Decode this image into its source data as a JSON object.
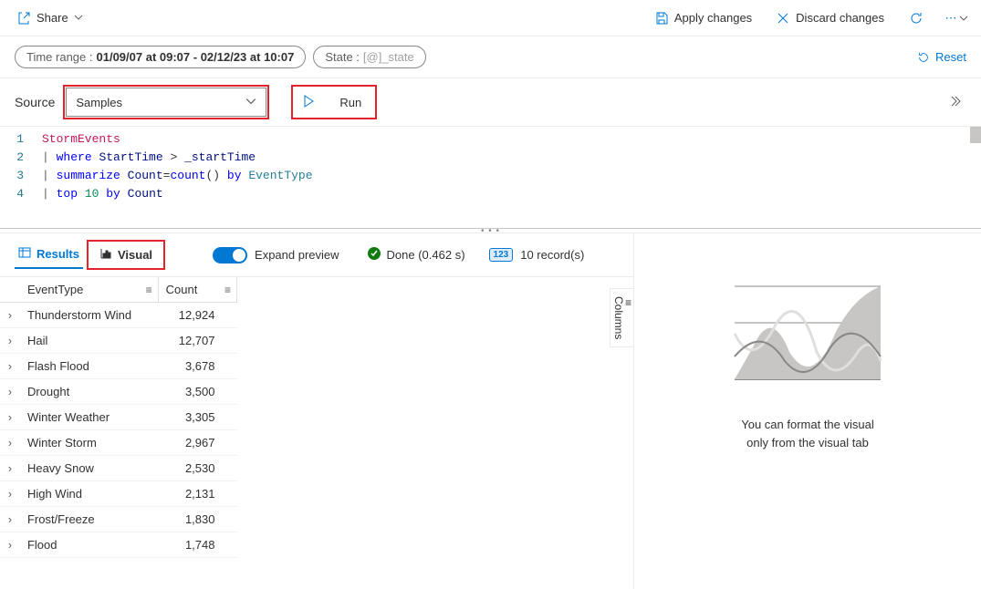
{
  "toolbar": {
    "share": "Share",
    "apply": "Apply changes",
    "discard": "Discard changes"
  },
  "chips": {
    "timerange_label": "Time range : ",
    "timerange_value": "01/09/07 at 09:07 - 02/12/23 at 10:07",
    "state_label": "State : ",
    "state_value": "[@]_state",
    "reset": "Reset"
  },
  "source": {
    "label": "Source",
    "selected": "Samples",
    "run": "Run"
  },
  "query": {
    "lines": [
      {
        "n": "1",
        "table": "StormEvents"
      },
      {
        "n": "2",
        "text": "| where StartTime > _startTime"
      },
      {
        "n": "3",
        "text": "| summarize Count=count() by EventType"
      },
      {
        "n": "4",
        "text": "| top 10 by Count"
      }
    ]
  },
  "results_bar": {
    "results_tab": "Results",
    "visual_tab": "Visual",
    "expand_preview": "Expand preview",
    "done": "Done (0.462 s)",
    "records": "10 record(s)",
    "badge": "123"
  },
  "table": {
    "columns": [
      "EventType",
      "Count"
    ],
    "rows": [
      {
        "EventType": "Thunderstorm Wind",
        "Count": "12,924"
      },
      {
        "EventType": "Hail",
        "Count": "12,707"
      },
      {
        "EventType": "Flash Flood",
        "Count": "3,678"
      },
      {
        "EventType": "Drought",
        "Count": "3,500"
      },
      {
        "EventType": "Winter Weather",
        "Count": "3,305"
      },
      {
        "EventType": "Winter Storm",
        "Count": "2,967"
      },
      {
        "EventType": "Heavy Snow",
        "Count": "2,530"
      },
      {
        "EventType": "High Wind",
        "Count": "2,131"
      },
      {
        "EventType": "Frost/Freeze",
        "Count": "1,830"
      },
      {
        "EventType": "Flood",
        "Count": "1,748"
      }
    ],
    "columns_panel": "Columns"
  },
  "right_panel": {
    "line1": "You can format the visual",
    "line2": "only from the visual tab"
  }
}
